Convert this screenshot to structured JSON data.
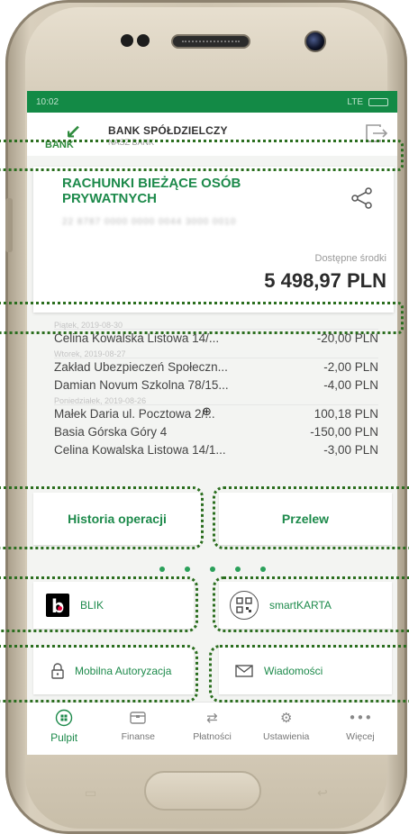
{
  "status_bar": {
    "time": "10:02",
    "network": "LTE"
  },
  "header": {
    "bank_name": "BANK SPÓŁDZIELCZY",
    "bank_subtitle": "NASZ BANK",
    "bank_short": "BANK"
  },
  "account": {
    "title": "RACHUNKI BIEŻĄCE OSÓB PRYWATNYCH",
    "number": "22 8787 0000 0000 0044 3000 0010",
    "available_label": "Dostępne środki",
    "available_amount": "5 498,97 PLN"
  },
  "transactions": [
    {
      "date": "Piątek, 2019-08-30"
    },
    {
      "desc": "Celina Kowalska Listowa 14/...",
      "amount": "-20,00 PLN"
    },
    {
      "date": "Wtorek, 2019-08-27"
    },
    {
      "desc": "Zakład Ubezpieczeń Społeczn...",
      "amount": "-2,00 PLN"
    },
    {
      "desc": "Damian Novum Szkolna 78/15...",
      "amount": "-4,00 PLN"
    },
    {
      "date": "Poniedziałek, 2019-08-26"
    },
    {
      "desc": "Małek Daria  ul. Pocztowa 2/...",
      "amount": "100,18 PLN"
    },
    {
      "desc": "Basia Górska Góry 4",
      "amount": "-150,00 PLN"
    },
    {
      "desc": "Celina Kowalska Listowa 14/1...",
      "amount": "-3,00 PLN"
    }
  ],
  "actions": {
    "history": "Historia operacji",
    "transfer": "Przelew",
    "blik": "BLIK",
    "smartkarta": "smartKARTA",
    "mobile_auth": "Mobilna Autoryzacja",
    "messages": "Wiadomości"
  },
  "pager": {
    "pages": 5,
    "active": 0
  },
  "bottom_nav": [
    {
      "label": "Pulpit",
      "icon": "home-icon",
      "active": true
    },
    {
      "label": "Finanse",
      "icon": "wallet-icon",
      "active": false
    },
    {
      "label": "Płatności",
      "icon": "transfer-arrows-icon",
      "active": false
    },
    {
      "label": "Ustawienia",
      "icon": "gear-icon",
      "active": false
    },
    {
      "label": "Więcej",
      "icon": "more-icon",
      "active": false
    }
  ],
  "colors": {
    "accent": "#1d8a4b",
    "status_bar": "#138a46",
    "highlight": "#2b6e1f"
  }
}
